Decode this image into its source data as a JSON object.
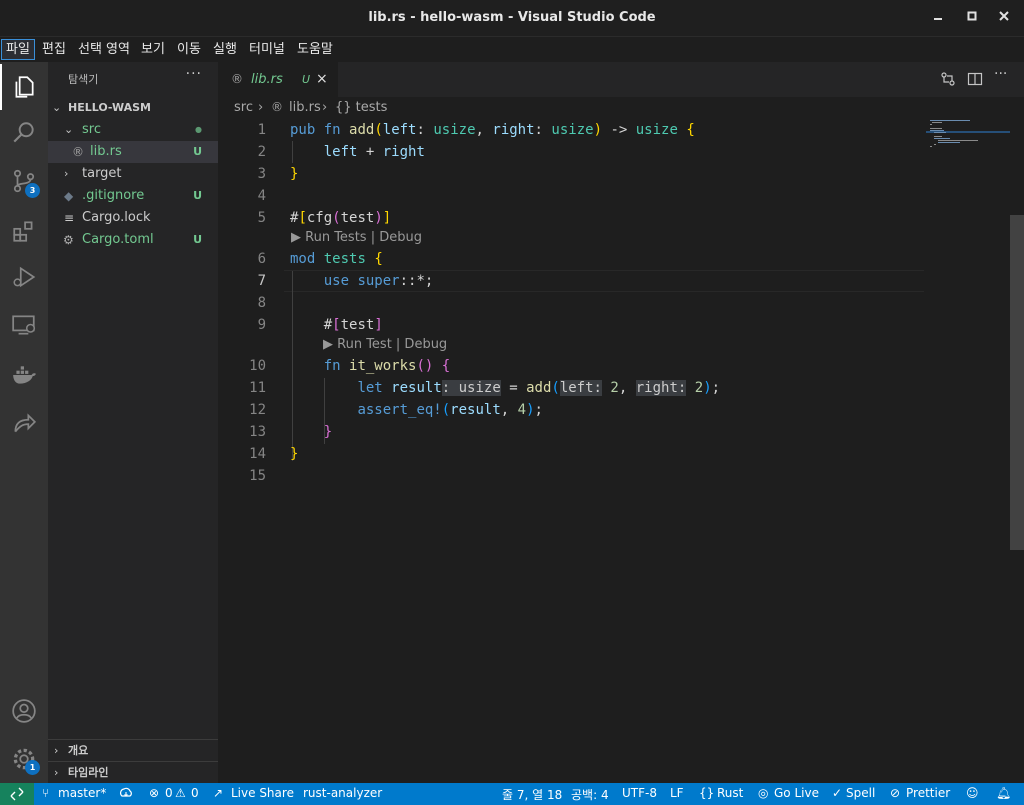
{
  "window": {
    "title": "lib.rs - hello-wasm - Visual Studio Code"
  },
  "menu": [
    "파일",
    "편집",
    "선택 영역",
    "보기",
    "이동",
    "실행",
    "터미널",
    "도움말"
  ],
  "activity": {
    "scm_badge": "3",
    "accounts_badge": "1"
  },
  "explorer": {
    "title": "탐색기",
    "more": "···",
    "folder": "HELLO-WASM",
    "items": [
      {
        "label": "src",
        "git": "●"
      },
      {
        "label": "lib.rs",
        "git": "U"
      },
      {
        "label": "target",
        "git": ""
      },
      {
        "label": ".gitignore",
        "git": "U"
      },
      {
        "label": "Cargo.lock",
        "git": ""
      },
      {
        "label": "Cargo.toml",
        "git": "U"
      }
    ],
    "sections": [
      "개요",
      "타임라인"
    ]
  },
  "tab": {
    "label": "lib.rs",
    "status": "U",
    "close": "×"
  },
  "breadcrumb": [
    "src",
    "lib.rs",
    "{} tests"
  ],
  "editor": {
    "line_numbers": [
      "1",
      "2",
      "3",
      "4",
      "5",
      "6",
      "7",
      "8",
      "9",
      "10",
      "11",
      "12",
      "13",
      "14",
      "15"
    ],
    "codelens_tests": "▶ Run Tests | Debug",
    "codelens_test": "▶ Run Test | Debug",
    "tokens": {
      "pub": "pub",
      "fn": "fn",
      "add": "add",
      "left": "left",
      "right": "right",
      "usize": "usize",
      "arrow": "->",
      "plus": "+",
      "hash": "#",
      "cfg": "cfg",
      "test": "test",
      "mod": "mod",
      "tests": "tests",
      "use": "use",
      "super": "super",
      "glob": "::*",
      "semi": ";",
      "it_works": "it_works",
      "let": "let",
      "result": "result",
      "assert_eq": "assert_eq!",
      "n2": "2",
      "n4": "4",
      "colon": ":",
      "comma": ",",
      "eq": "="
    }
  },
  "status": {
    "branch": "master*",
    "problems_errors": "0",
    "problems_warnings": "0",
    "live_share": "Live Share",
    "analyzer": "rust-analyzer",
    "position": "줄 7, 열 18",
    "spaces": "공백: 4",
    "encoding": "UTF-8",
    "eol": "LF",
    "language": "Rust",
    "go_live": "Go Live",
    "spell": "Spell",
    "prettier": "Prettier"
  },
  "colors": {
    "accent": "#007acc",
    "git_untracked": "#73c991",
    "remote": "#16825d"
  }
}
